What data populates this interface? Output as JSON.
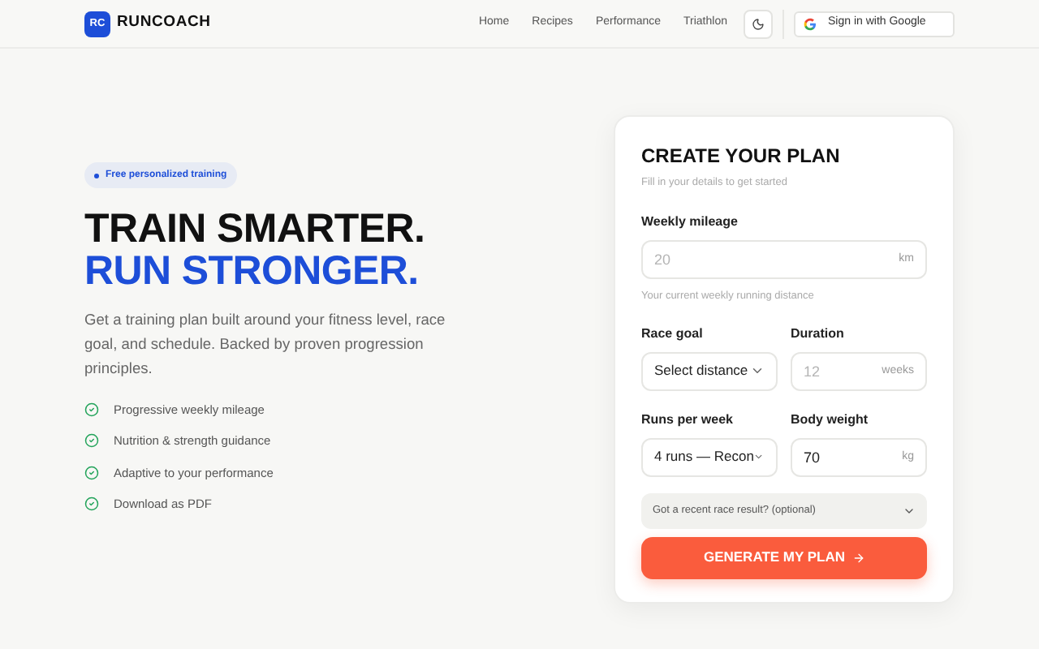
{
  "header": {
    "logo_mark": "RC",
    "brand": "RUNCOACH",
    "nav": [
      "Home",
      "Recipes",
      "Performance",
      "Triathlon"
    ],
    "sign_in": "Sign in with Google"
  },
  "hero": {
    "badge": "Free personalized training",
    "headline_1": "TRAIN SMARTER.",
    "headline_2": "RUN STRONGER.",
    "description": "Get a training plan built around your fitness level, race goal, and schedule. Backed by proven progression principles.",
    "features": [
      "Progressive weekly mileage",
      "Nutrition & strength guidance",
      "Adaptive to your performance",
      "Download as PDF"
    ]
  },
  "form": {
    "title": "CREATE YOUR PLAN",
    "subtitle": "Fill in your details to get started",
    "weekly_mileage": {
      "label": "Weekly mileage",
      "placeholder": "20",
      "unit": "km",
      "hint": "Your current weekly running distance"
    },
    "race_goal": {
      "label": "Race goal",
      "value": "Select distance"
    },
    "duration": {
      "label": "Duration",
      "placeholder": "12",
      "unit": "weeks"
    },
    "runs_per_week": {
      "label": "Runs per week",
      "value": "4 runs — Recon"
    },
    "body_weight": {
      "label": "Body weight",
      "value": "70",
      "unit": "kg"
    },
    "race_result": {
      "label": "Got a recent race result? (optional)",
      "expanded": false
    },
    "submit": "GENERATE MY PLAN"
  }
}
